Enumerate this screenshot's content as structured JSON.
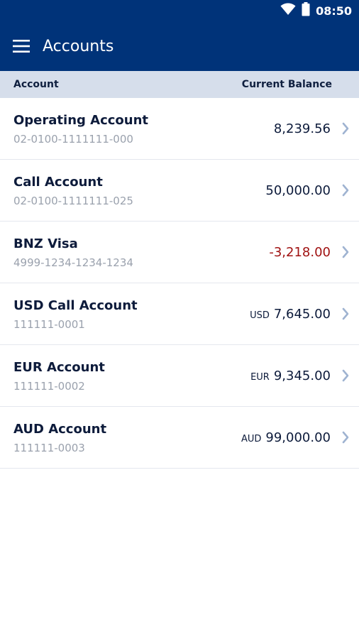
{
  "status": {
    "time": "08:50"
  },
  "header": {
    "title": "Accounts"
  },
  "columns": {
    "account": "Account",
    "balance": "Current Balance"
  },
  "accounts": [
    {
      "name": "Operating Account",
      "number": "02-0100-1111111-000",
      "currency": "",
      "balance": "8,239.56",
      "negative": false
    },
    {
      "name": "Call Account",
      "number": "02-0100-1111111-025",
      "currency": "",
      "balance": "50,000.00",
      "negative": false
    },
    {
      "name": "BNZ Visa",
      "number": "4999-1234-1234-1234",
      "currency": "",
      "balance": "-3,218.00",
      "negative": true
    },
    {
      "name": "USD Call Account",
      "number": "111111-0001",
      "currency": "USD",
      "balance": "7,645.00",
      "negative": false
    },
    {
      "name": "EUR Account",
      "number": "111111-0002",
      "currency": "EUR",
      "balance": "9,345.00",
      "negative": false
    },
    {
      "name": "AUD Account",
      "number": "111111-0003",
      "currency": "AUD",
      "balance": "99,000.00",
      "negative": false
    }
  ],
  "colors": {
    "brand": "#003379",
    "header_band": "#d6deeb",
    "negative": "#a01212",
    "chevron": "#9fb3d1"
  },
  "icons": [
    "wifi-icon",
    "battery-icon",
    "menu-icon",
    "chevron-right-icon"
  ]
}
